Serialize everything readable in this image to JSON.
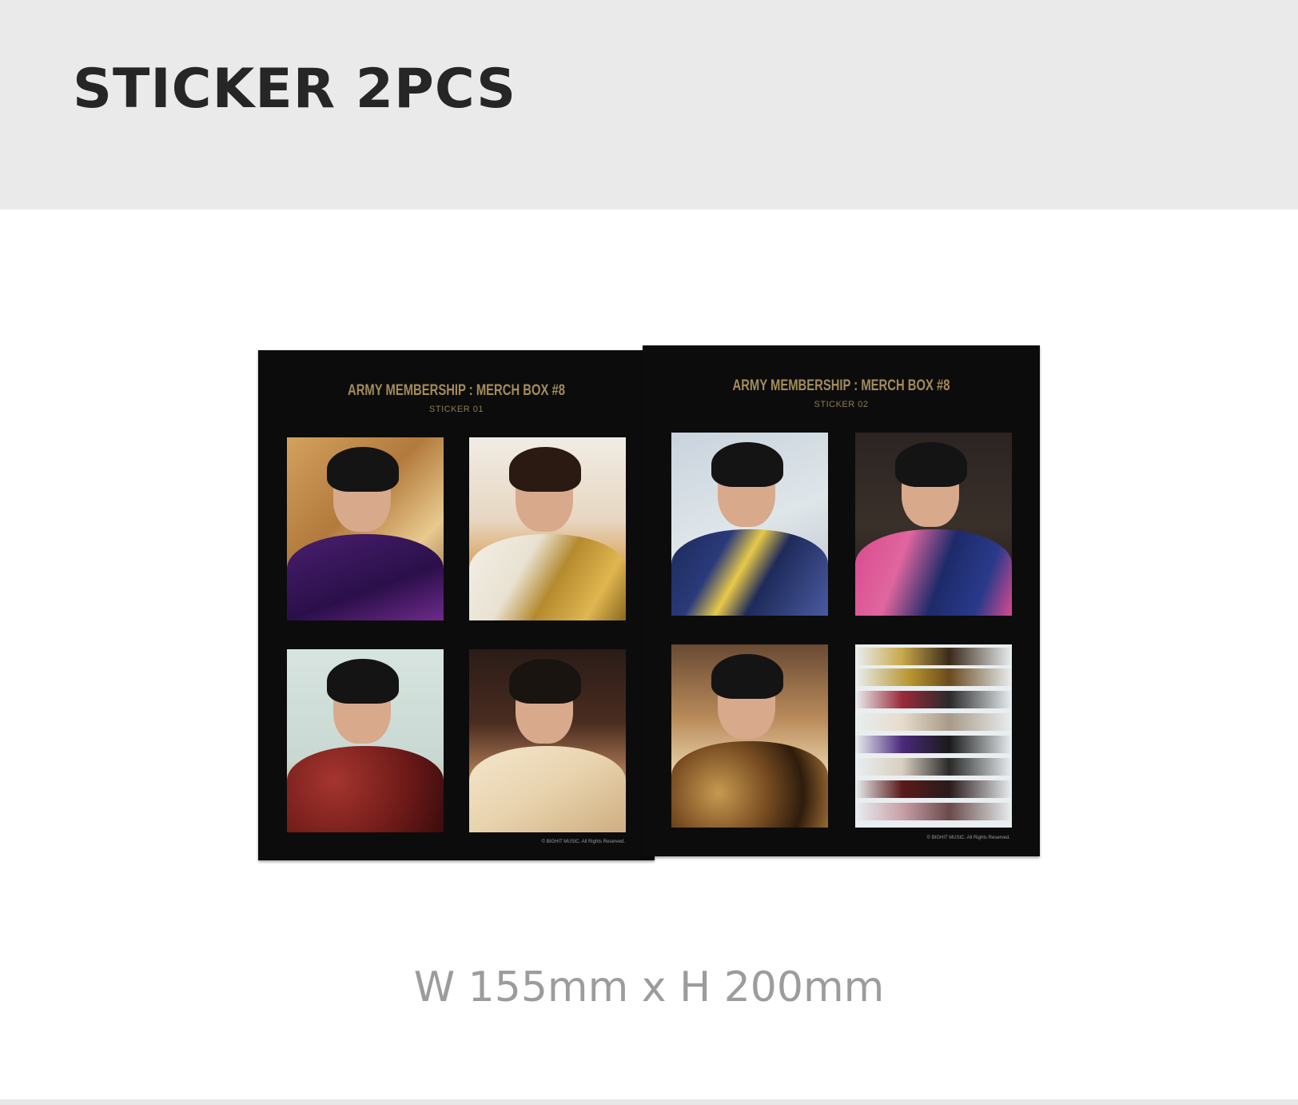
{
  "section": {
    "title": "STICKER 2PCS",
    "dimensions": "W 155mm x H 200mm"
  },
  "sheets": [
    {
      "title": "ARMY MEMBERSHIP : MERCH BOX #8",
      "subtitle": "STICKER 01",
      "copyright": "© BIGHIT MUSIC. All Rights Reserved."
    },
    {
      "title": "ARMY MEMBERSHIP : MERCH BOX #8",
      "subtitle": "STICKER 02",
      "copyright": "© BIGHIT MUSIC. All Rights Reserved."
    }
  ],
  "colors": {
    "header_band": "#eaeaea",
    "sheet": "#0c0c0c",
    "sheet_title_gold": "#a48b5a",
    "dimension_text": "#9c9c9c"
  }
}
